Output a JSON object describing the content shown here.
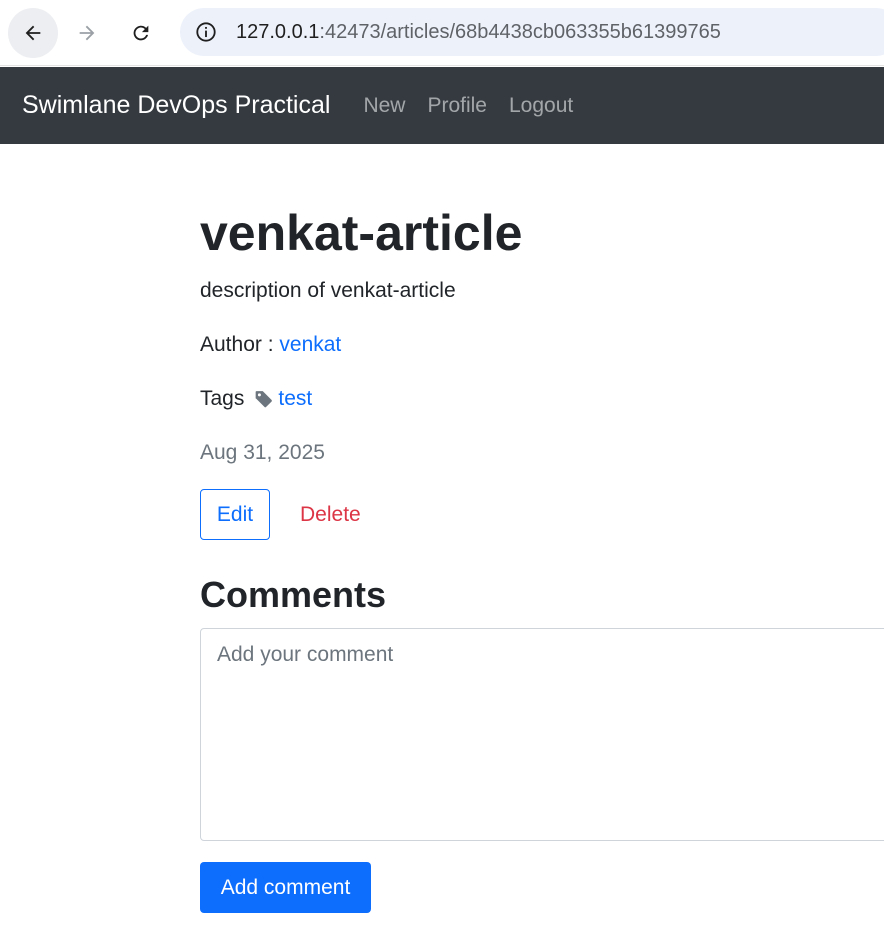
{
  "browser": {
    "url_host": "127.0.0.1",
    "url_rest": ":42473/articles/68b4438cb063355b61399765"
  },
  "navbar": {
    "brand": "Swimlane DevOps Practical",
    "links": [
      "New",
      "Profile",
      "Logout"
    ]
  },
  "article": {
    "title": "venkat-article",
    "description": "description of venkat-article",
    "author_label": "Author : ",
    "author": "venkat",
    "tags_label": "Tags",
    "tags": [
      "test"
    ],
    "date": "Aug 31, 2025",
    "edit_label": "Edit",
    "delete_label": "Delete"
  },
  "comments": {
    "heading": "Comments",
    "placeholder": "Add your comment",
    "submit_label": "Add comment"
  },
  "colors": {
    "navbar_bg": "#343a40",
    "primary": "#0d6efd",
    "danger": "#dc3545",
    "muted": "#6c757d"
  }
}
